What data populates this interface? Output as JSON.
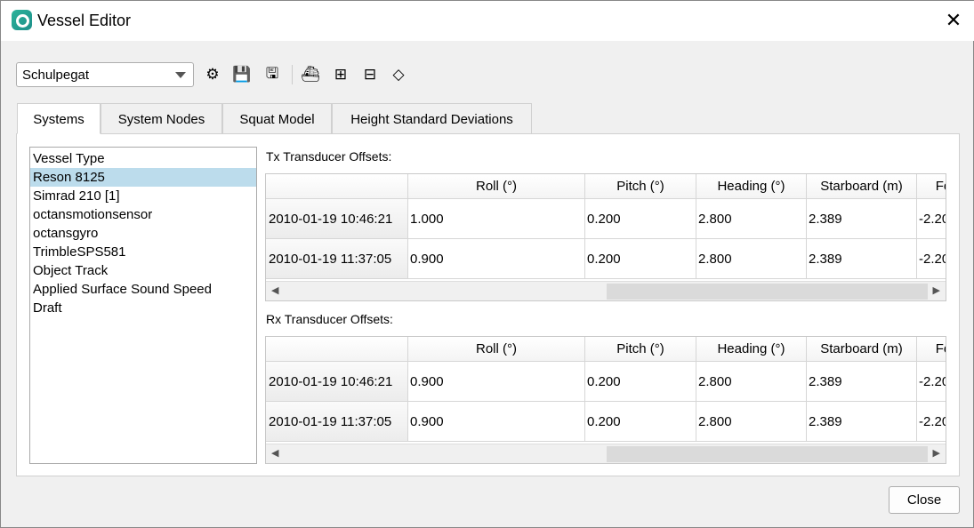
{
  "window": {
    "title": "Vessel Editor",
    "close_icon": "close-icon"
  },
  "toolbar": {
    "vessel": "Schulpegat",
    "icons": [
      "vessel-config-icon",
      "save-icon",
      "save-as-icon",
      "edit-sensor-icon",
      "add-timestamp-icon",
      "remove-timestamp-icon",
      "coordinate-axes-icon"
    ]
  },
  "tabs": [
    {
      "label": "Systems",
      "active": true
    },
    {
      "label": "System Nodes"
    },
    {
      "label": "Squat Model"
    },
    {
      "label": "Height Standard Deviations"
    }
  ],
  "systems": {
    "items": [
      "Vessel Type",
      "Reson 8125",
      "Simrad 210 [1]",
      "octansmotionsensor",
      "octansgyro",
      "TrimbleSPS581",
      "Object Track",
      "Applied Surface Sound Speed",
      "Draft"
    ],
    "selected": "Reson 8125"
  },
  "tx": {
    "label": "Tx Transducer Offsets:",
    "columns": [
      "Roll (°)",
      "Pitch (°)",
      "Heading (°)",
      "Starboard (m)",
      "Fo"
    ],
    "rows": [
      {
        "time": "2010-01-19 10:46:21",
        "values": [
          "1.000",
          "0.200",
          "2.800",
          "2.389",
          "-2.20"
        ]
      },
      {
        "time": "2010-01-19 11:37:05",
        "values": [
          "0.900",
          "0.200",
          "2.800",
          "2.389",
          "-2.20"
        ]
      }
    ]
  },
  "rx": {
    "label": "Rx Transducer Offsets:",
    "columns": [
      "Roll (°)",
      "Pitch (°)",
      "Heading (°)",
      "Starboard (m)",
      "Fo"
    ],
    "rows": [
      {
        "time": "2010-01-19 10:46:21",
        "values": [
          "0.900",
          "0.200",
          "2.800",
          "2.389",
          "-2.20"
        ]
      },
      {
        "time": "2010-01-19 11:37:05",
        "values": [
          "0.900",
          "0.200",
          "2.800",
          "2.389",
          "-2.20"
        ]
      }
    ]
  },
  "footer": {
    "close": "Close"
  }
}
